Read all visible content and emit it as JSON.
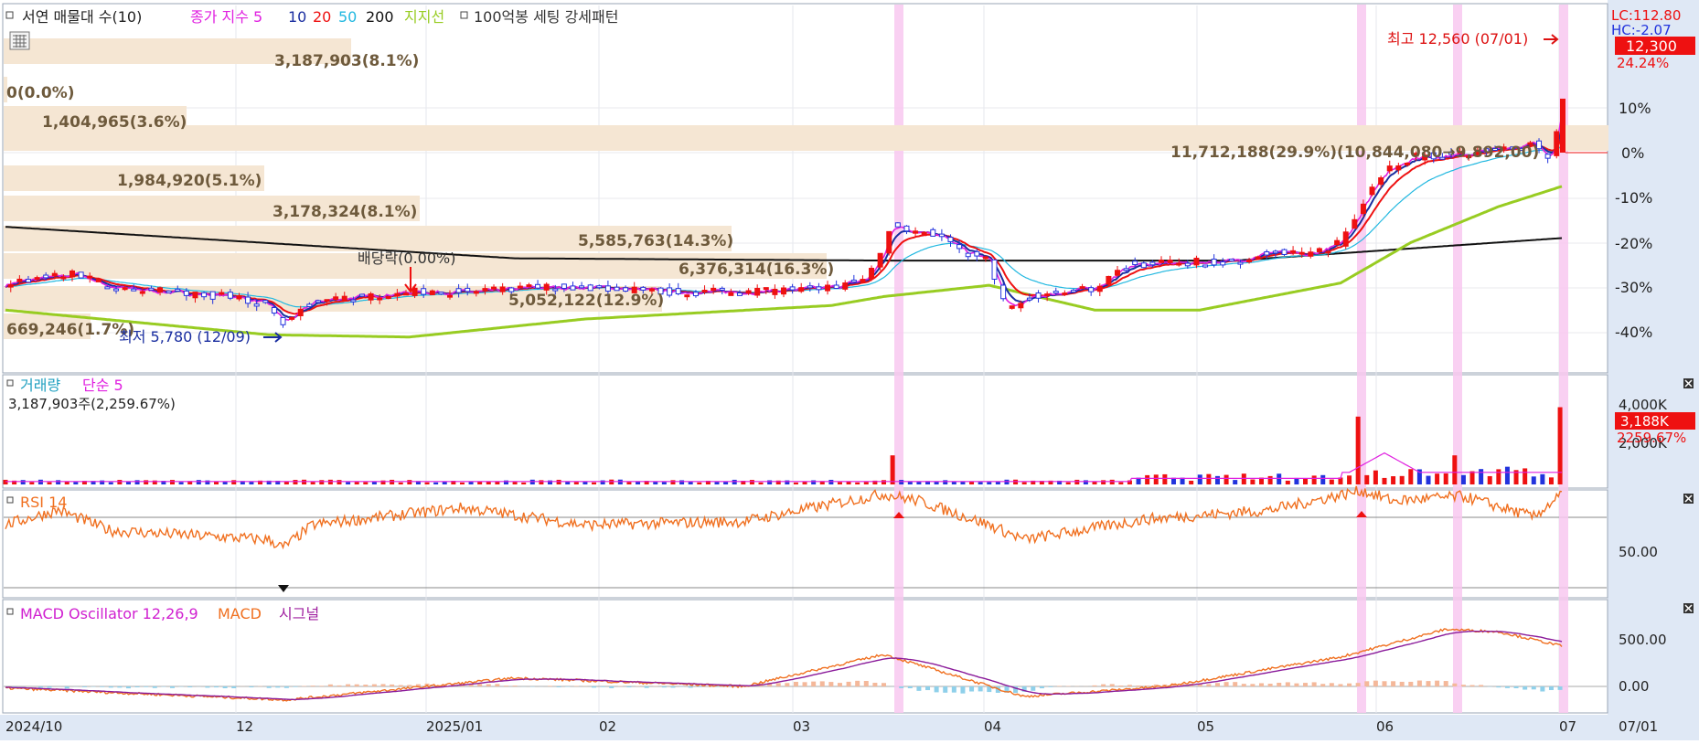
{
  "legend": {
    "main_items": [
      {
        "label": "서연 매물대 수(10)",
        "color": "#222222"
      },
      {
        "label": "종가 지수 5",
        "color": "#e020e0"
      },
      {
        "label": "10",
        "color": "#1a2ea0"
      },
      {
        "label": "20",
        "color": "#ee1111"
      },
      {
        "label": "50",
        "color": "#22b8e0"
      },
      {
        "label": "200",
        "color": "#111111"
      },
      {
        "label": "지지선",
        "color": "#98cc22"
      },
      {
        "label": "100억봉 세팅 강세패턴",
        "color": "#333333"
      }
    ],
    "volume_items": [
      {
        "label": "거래량",
        "color": "#20a0c0"
      },
      {
        "label": "단순 5",
        "color": "#e020e0"
      }
    ],
    "rsi_items": [
      {
        "label": "RSI 14",
        "color": "#f07020"
      }
    ],
    "macd_items": [
      {
        "label": "MACD Oscillator 12,26,9",
        "color": "#d020d0"
      },
      {
        "label": "MACD",
        "color": "#f07020"
      },
      {
        "label": "시그널",
        "color": "#a020a0"
      }
    ]
  },
  "header_right": {
    "lc": "LC:112.80",
    "hc": "HC:-2.07"
  },
  "price_axis": {
    "ticks": [
      "10%",
      "0%",
      "-10%",
      "-20%",
      "-30%",
      "-40%"
    ],
    "current_price": "12,300",
    "current_change": "24.24%"
  },
  "volume_axis": {
    "ticks": [
      "4,000K",
      "2,000K"
    ],
    "current": "3,188K",
    "current_pct": "2259.67%"
  },
  "rsi_axis": {
    "ticks": [
      "50.00"
    ]
  },
  "macd_axis": {
    "ticks": [
      "500.00",
      "0.00"
    ]
  },
  "x_axis": {
    "labels": [
      "2024/10",
      "12",
      "2025/01",
      "02",
      "03",
      "04",
      "05",
      "06",
      "07"
    ],
    "right_label": "07/01"
  },
  "volume_info": "3,187,903주(2,259.67%)",
  "profile_labels": [
    "3,187,903(8.1%)",
    "0(0.0%)",
    "1,404,965(3.6%)",
    "11,712,188(29.9%)(10,844,080→9,892,00)",
    "1,984,920(5.1%)",
    "3,178,324(8.1%)",
    "5,585,763(14.3%)",
    "6,376,314(16.3%)",
    "5,052,122(12.9%)",
    "669,246(1.7%)"
  ],
  "annotations": {
    "high": "최고 12,560 (07/01)",
    "low": "최저 5,780 (12/09)",
    "dividend": "배당락(0.00%)"
  },
  "colors": {
    "up": "#ee1111",
    "down": "#2233dd",
    "ma5": "#e020e0",
    "ma10": "#1a2ea0",
    "ma20": "#ee1111",
    "ma50": "#22b8e0",
    "ma200": "#111111",
    "support": "#98cc22",
    "profile": "#f5e6d3",
    "highlight": "#f8c8f0",
    "axis_bg": "#dfe8f5"
  },
  "chart_data": {
    "type": "candlestick",
    "y_unit": "% vs reference price",
    "ylim": [
      -45,
      18
    ],
    "months": [
      "2024/10",
      "12",
      "2025/01",
      "02",
      "03",
      "04",
      "05",
      "06",
      "07"
    ],
    "highlight_periods": [
      "2025/03 mid",
      "2025/05 end",
      "2025/06 mid",
      "2025/07/01"
    ],
    "price_anchors": [
      [
        0,
        -29
      ],
      [
        40,
        -27
      ],
      [
        60,
        -30
      ],
      [
        90,
        -31
      ],
      [
        130,
        -32
      ],
      [
        150,
        -34
      ],
      [
        158,
        -38
      ],
      [
        175,
        -33
      ],
      [
        230,
        -31
      ],
      [
        270,
        -31
      ],
      [
        300,
        -30
      ],
      [
        340,
        -30
      ],
      [
        380,
        -31
      ],
      [
        420,
        -31
      ],
      [
        470,
        -30
      ],
      [
        490,
        -28
      ],
      [
        500,
        -22
      ],
      [
        505,
        -15
      ],
      [
        510,
        -17
      ],
      [
        530,
        -18
      ],
      [
        545,
        -22
      ],
      [
        560,
        -24
      ],
      [
        570,
        -35
      ],
      [
        585,
        -32
      ],
      [
        620,
        -30
      ],
      [
        640,
        -25
      ],
      [
        700,
        -24
      ],
      [
        720,
        -22
      ],
      [
        740,
        -23
      ],
      [
        760,
        -20
      ],
      [
        772,
        -12
      ],
      [
        782,
        -5
      ],
      [
        800,
        -1
      ],
      [
        830,
        -0.5
      ],
      [
        850,
        1
      ],
      [
        870,
        2
      ],
      [
        880,
        -1
      ],
      [
        886,
        12
      ]
    ],
    "ma200_anchors": [
      [
        0,
        -16.5
      ],
      [
        290,
        -23.5
      ],
      [
        500,
        -24
      ],
      [
        700,
        -24
      ],
      [
        886,
        -19
      ]
    ],
    "support_anchors": [
      [
        0,
        -35
      ],
      [
        150,
        -40.5
      ],
      [
        230,
        -41
      ],
      [
        330,
        -37
      ],
      [
        470,
        -34
      ],
      [
        500,
        -32
      ],
      [
        560,
        -29.5
      ],
      [
        620,
        -35
      ],
      [
        680,
        -35
      ],
      [
        760,
        -29
      ],
      [
        800,
        -20
      ],
      [
        850,
        -12
      ],
      [
        886,
        -7.5
      ]
    ],
    "volume_spikes": [
      [
        505,
        1200
      ],
      [
        772,
        2800
      ],
      [
        825,
        1200
      ],
      [
        886,
        3188
      ]
    ],
    "rsi_anchors": [
      [
        0,
        55
      ],
      [
        30,
        68
      ],
      [
        60,
        50
      ],
      [
        150,
        42
      ],
      [
        158,
        35
      ],
      [
        175,
        55
      ],
      [
        260,
        70
      ],
      [
        330,
        55
      ],
      [
        420,
        58
      ],
      [
        500,
        82
      ],
      [
        520,
        76
      ],
      [
        560,
        55
      ],
      [
        580,
        42
      ],
      [
        650,
        60
      ],
      [
        720,
        68
      ],
      [
        772,
        85
      ],
      [
        790,
        76
      ],
      [
        830,
        80
      ],
      [
        870,
        62
      ],
      [
        886,
        82
      ]
    ],
    "macd_anchors": [
      [
        0,
        -20
      ],
      [
        160,
        -160
      ],
      [
        290,
        100
      ],
      [
        420,
        0
      ],
      [
        500,
        380
      ],
      [
        580,
        -120
      ],
      [
        660,
        0
      ],
      [
        760,
        350
      ],
      [
        820,
        680
      ],
      [
        850,
        650
      ],
      [
        886,
        480
      ]
    ]
  }
}
